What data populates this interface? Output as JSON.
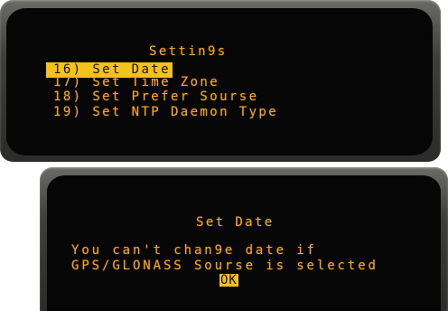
{
  "settings_panel": {
    "title": "Settin9s",
    "items": [
      {
        "number": "16)",
        "label": "16) Set Date",
        "selected": true
      },
      {
        "number": "17)",
        "label": "17) Set Time Zone",
        "selected": false
      },
      {
        "number": "18)",
        "label": "18) Set Prefer Sourse",
        "selected": false
      },
      {
        "number": "19)",
        "label": "19) Set NTP Daemon Type",
        "selected": false
      }
    ]
  },
  "dialog_panel": {
    "title": "Set Date",
    "message_line1": "You can't chan9e date if",
    "message_line2": "GPS/GLONASS Sourse is selected",
    "ok_label": "OK"
  },
  "colors": {
    "lcd_text": "#f2a51e",
    "highlight": "#f5c21a",
    "screen_bg": "#060606",
    "bezel": "#3e3e3b"
  }
}
